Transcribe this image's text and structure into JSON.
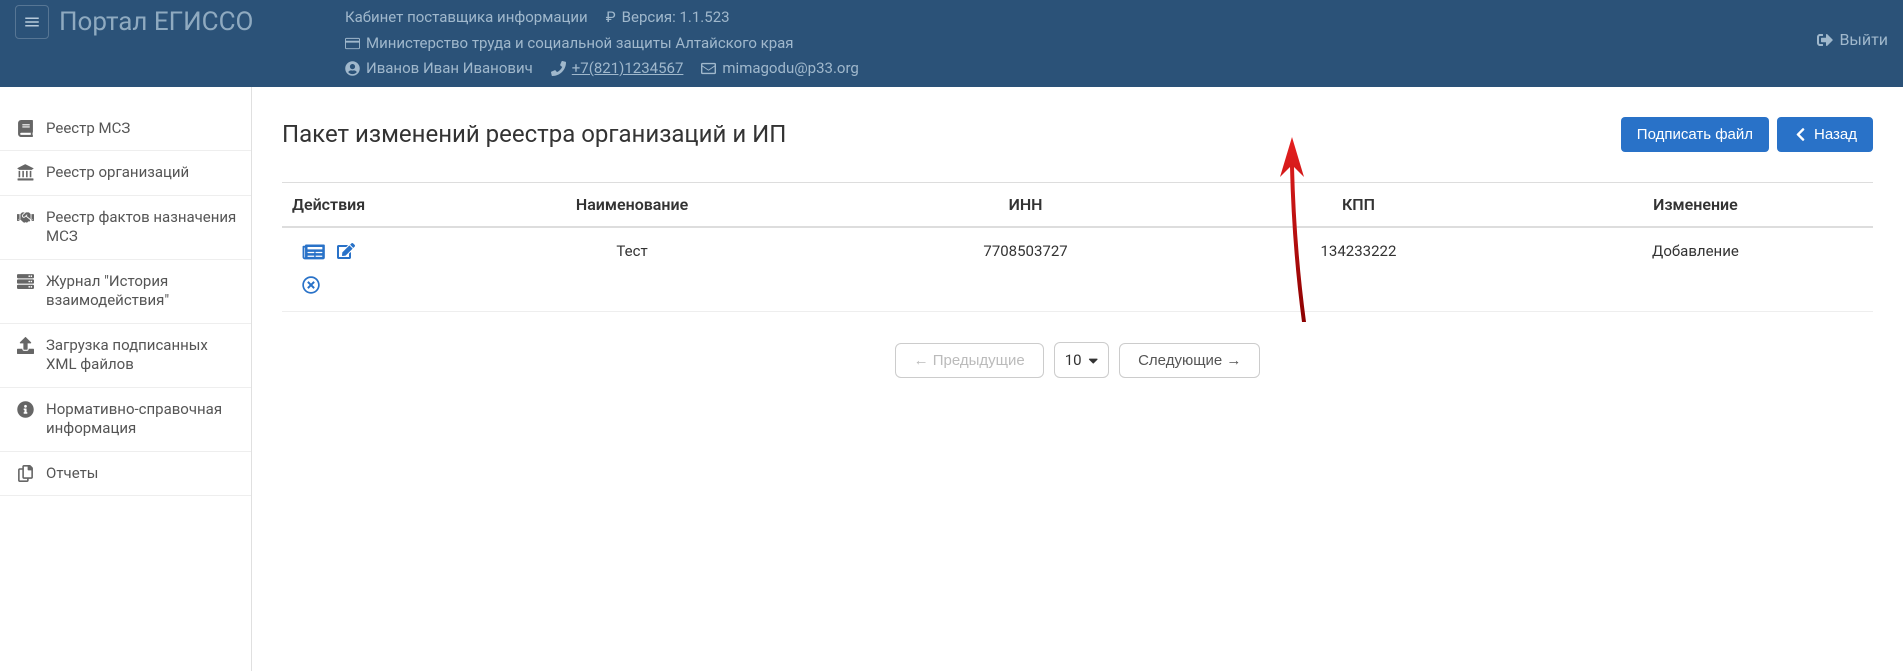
{
  "header": {
    "portal_title": "Портал ЕГИССО",
    "cabinet_label": "Кабинет поставщика информации",
    "version_label": "Версия: 1.1.523",
    "ministry": "Министерство труда и социальной защиты Алтайского края",
    "user_name": "Иванов Иван Иванович",
    "phone": "+7(821)1234567",
    "email": "mimagodu@p33.org",
    "logout": "Выйти"
  },
  "sidebar": {
    "items": [
      {
        "label": "Реестр МСЗ"
      },
      {
        "label": "Реестр организаций"
      },
      {
        "label": "Реестр фактов назначения МСЗ"
      },
      {
        "label": "Журнал \"История взаимодействия\""
      },
      {
        "label": "Загрузка подписанных XML файлов"
      },
      {
        "label": "Нормативно-справочная информация"
      },
      {
        "label": "Отчеты"
      }
    ]
  },
  "main": {
    "title": "Пакет изменений реестра организаций и ИП",
    "sign_button": "Подписать файл",
    "back_button": "Назад",
    "columns": {
      "actions": "Действия",
      "name": "Наименование",
      "inn": "ИНН",
      "kpp": "КПП",
      "change": "Изменение"
    },
    "rows": [
      {
        "name": "Тест",
        "inn": "7708503727",
        "kpp": "134233222",
        "change": "Добавление"
      }
    ],
    "pagination": {
      "prev": "← Предыдущие",
      "next": "Следующие →",
      "page_size": "10"
    }
  }
}
